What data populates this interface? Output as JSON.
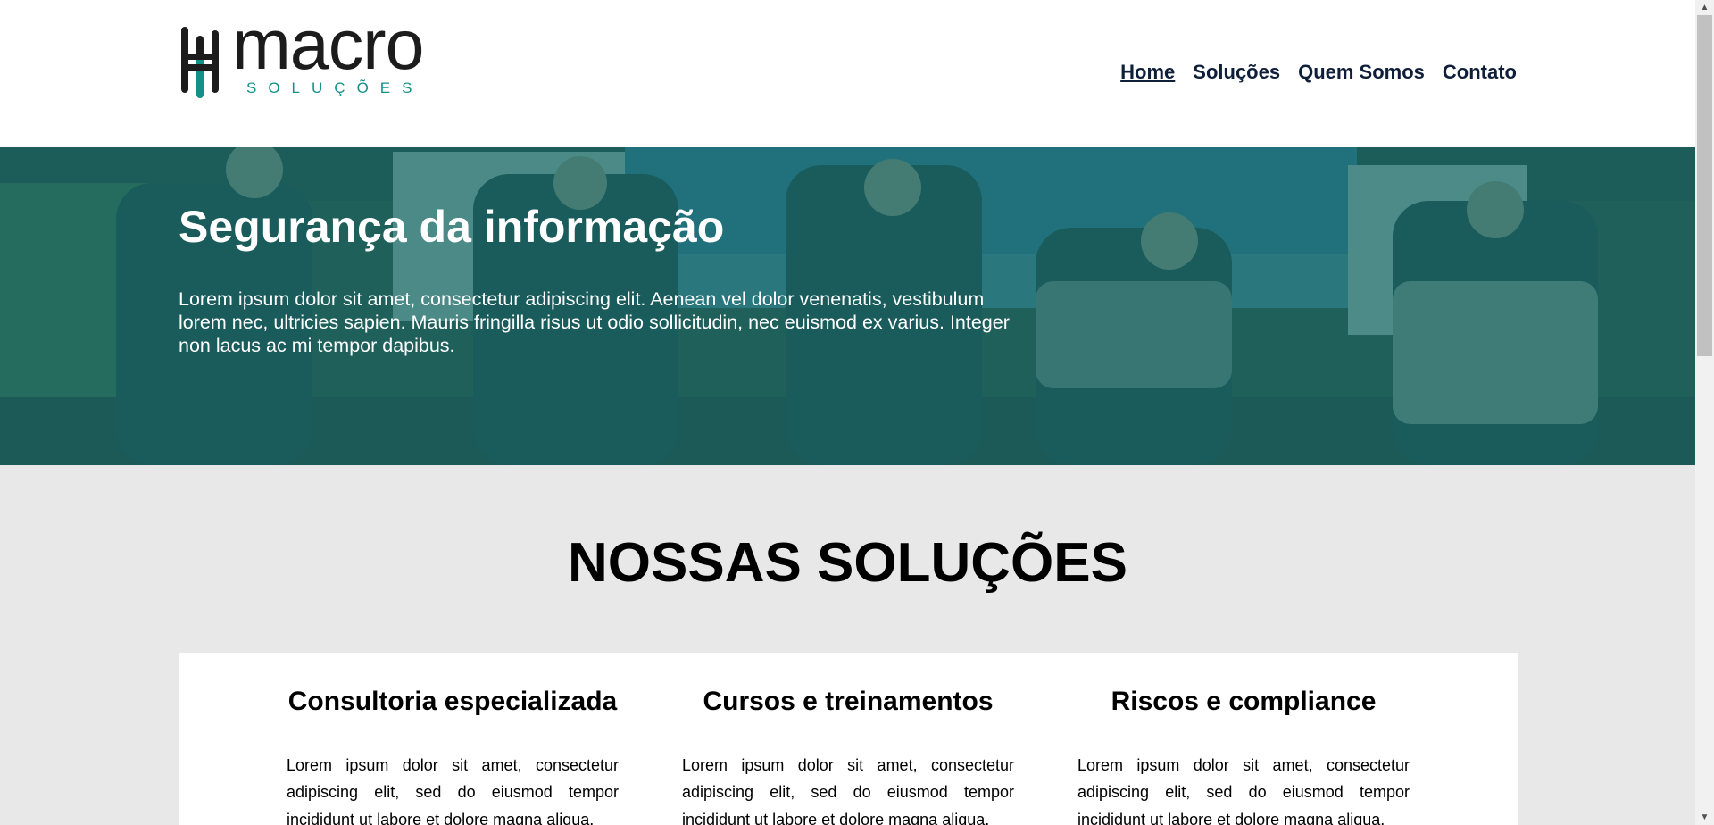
{
  "header": {
    "logo": {
      "word": "macro",
      "sub": "SOLUÇÕES"
    },
    "nav": [
      {
        "label": "Home",
        "active": true
      },
      {
        "label": "Soluções"
      },
      {
        "label": "Quem Somos"
      },
      {
        "label": "Contato"
      }
    ]
  },
  "hero": {
    "title": "Segurança da informação",
    "text": "Lorem ipsum dolor sit amet, consectetur adipiscing elit. Aenean vel dolor venenatis, vestibulum lorem nec, ultricies sapien. Mauris fringilla risus ut odio sollicitudin, nec euismod ex varius. Integer non lacus ac mi tempor dapibus."
  },
  "solucoes": {
    "title": "NOSSAS SOLUÇÕES",
    "cards": [
      {
        "title": "Consultoria especializada",
        "text": "Lorem ipsum dolor sit amet, consectetur adipiscing elit, sed do eiusmod tempor incididunt ut labore et dolore magna aliqua."
      },
      {
        "title": "Cursos e treinamentos",
        "text": "Lorem ipsum dolor sit amet, consectetur adipiscing elit, sed do eiusmod tempor incididunt ut labore et dolore magna aliqua."
      },
      {
        "title": "Riscos e compliance",
        "text": "Lorem ipsum dolor sit amet, consectetur adipiscing elit, sed do eiusmod tempor incididunt ut labore et dolore magna aliqua."
      }
    ]
  },
  "colors": {
    "brand_teal": "#13908a",
    "nav_text": "#0f1f3a",
    "hero_overlay": "#166c68",
    "section_bg": "#e8e8e8"
  },
  "icons": {
    "logo_mark": "macro-logo-icon",
    "scroll_up": "scroll-up-arrow-icon",
    "scroll_down": "scroll-down-arrow-icon"
  }
}
